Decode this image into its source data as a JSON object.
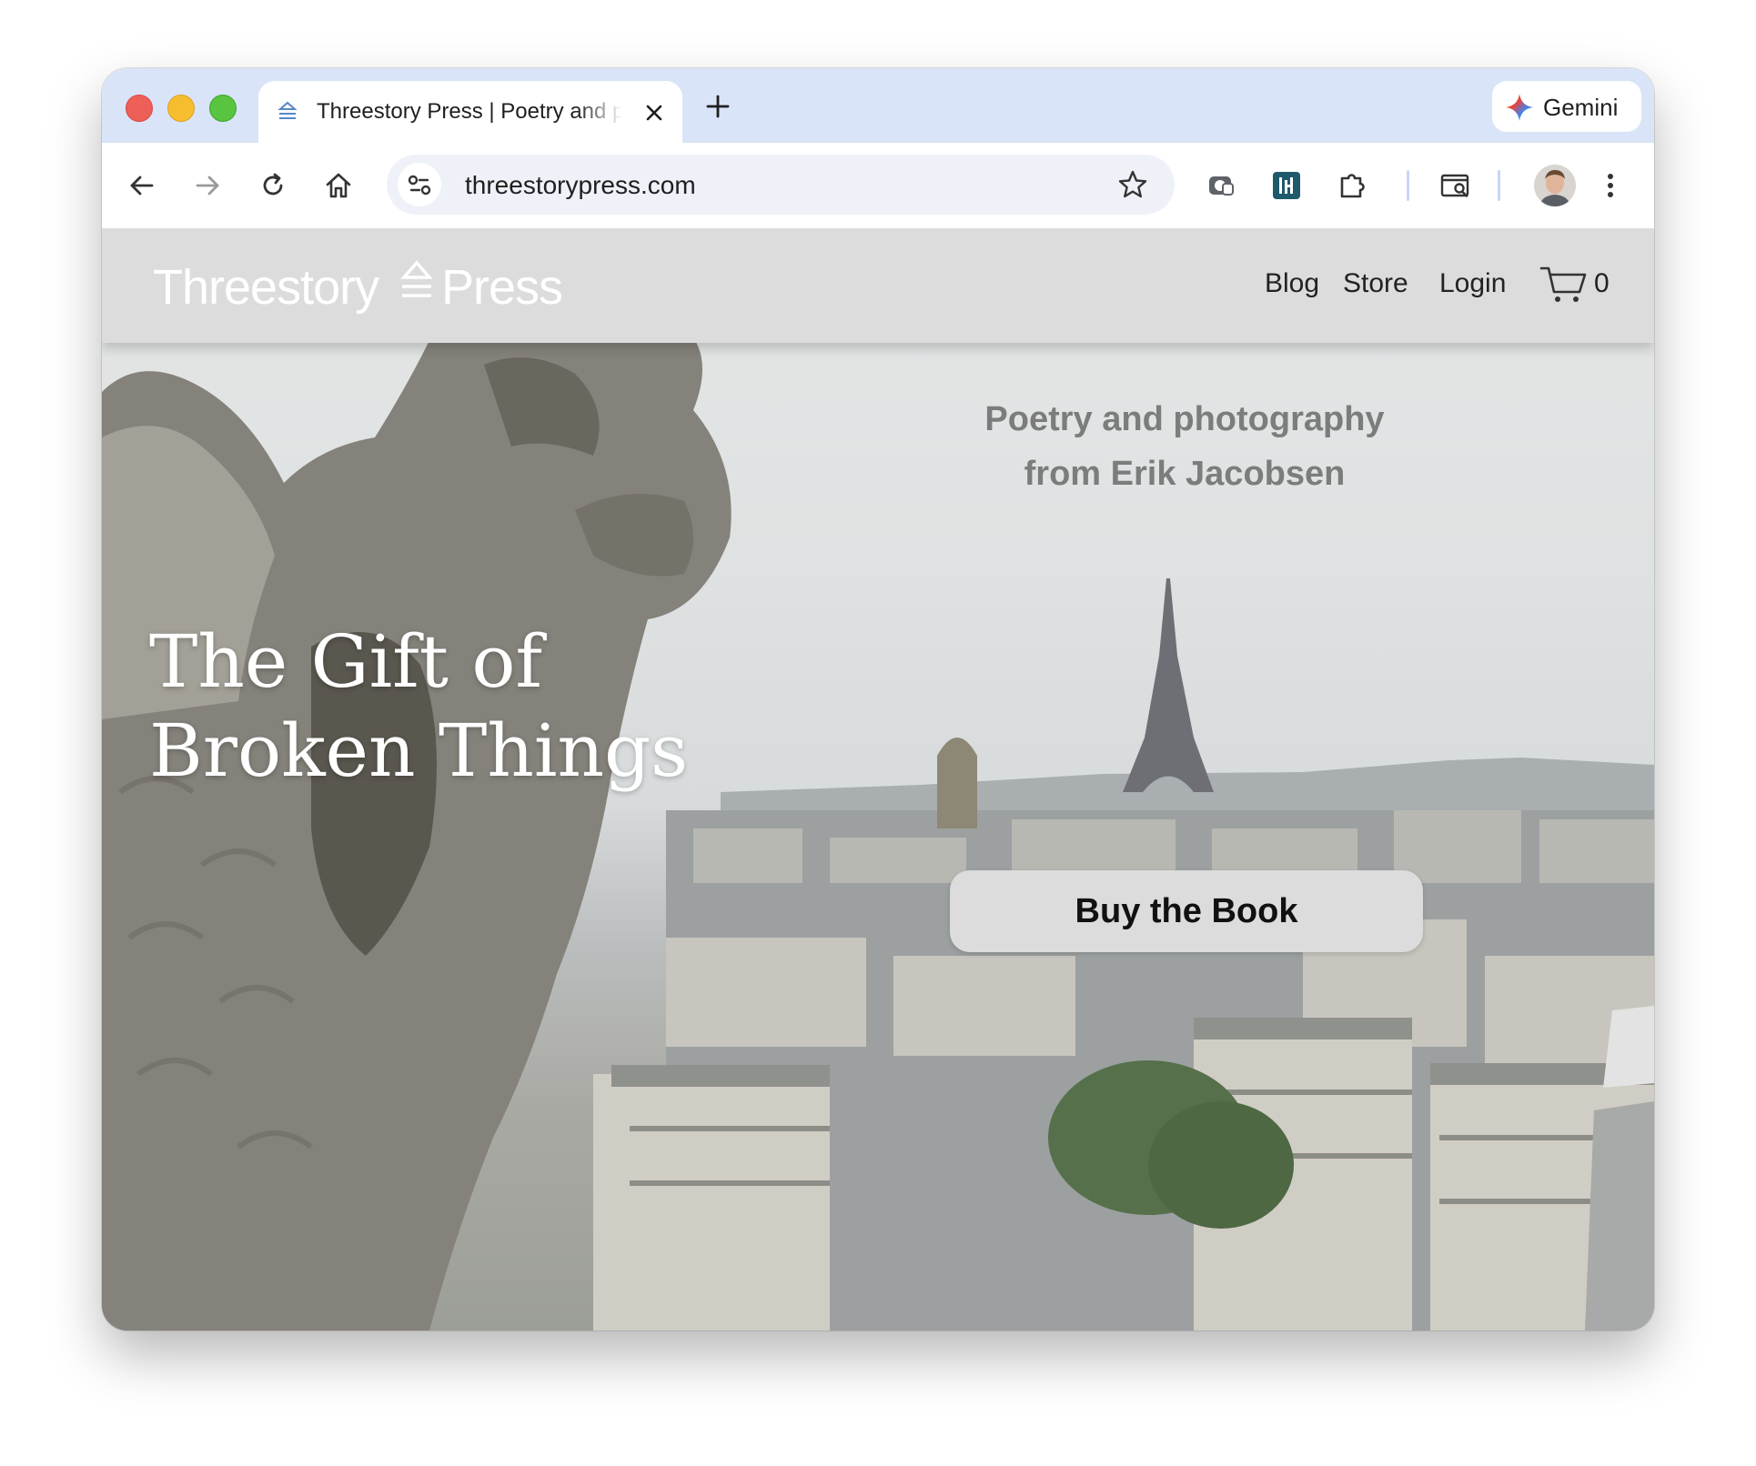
{
  "browser": {
    "tab": {
      "title": "Threestory Press | Poetry and photography"
    },
    "gemini_label": "Gemini",
    "url": "threestorypress.com",
    "icons": {
      "back": "arrow-left-icon",
      "forward": "arrow-right-icon",
      "reload": "reload-icon",
      "home": "home-icon",
      "site_info": "tune-icon",
      "bookmark": "star-icon",
      "extensions": "puzzle-icon",
      "menu": "kebab-icon"
    }
  },
  "site": {
    "logo": {
      "word1": "Threestory",
      "word2": "Press"
    },
    "nav": {
      "blog": "Blog",
      "store": "Store",
      "login": "Login",
      "cart_count": "0"
    },
    "hero": {
      "tagline_line1": "Poetry and photography",
      "tagline_line2": "from Erik Jacobsen",
      "title_line1": "The Gift of",
      "title_line2": "Broken Things",
      "cta": "Buy the Book"
    }
  },
  "colors": {
    "tabstrip": "#dae4f8",
    "header": "#dcdcdc",
    "cta_background": "#dcdcdc",
    "tagline": "#7c7c7c"
  }
}
